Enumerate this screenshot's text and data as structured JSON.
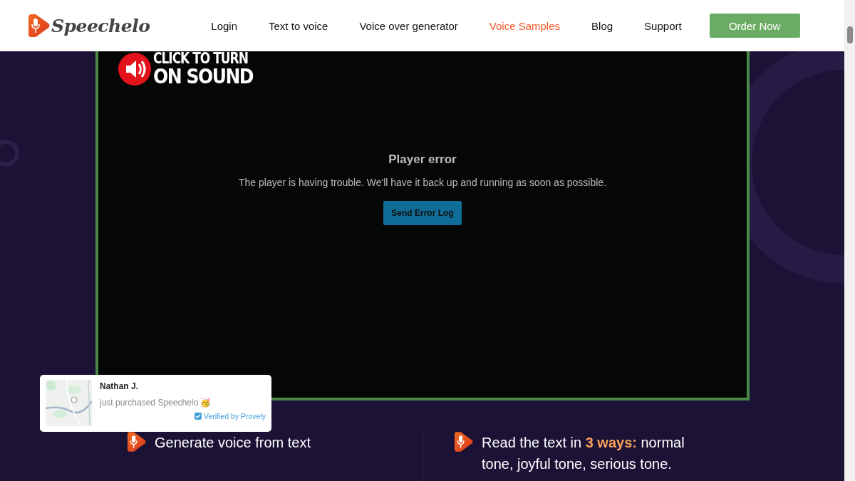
{
  "header": {
    "logo": "Speechelo",
    "nav": [
      {
        "label": "Login",
        "selected": false
      },
      {
        "label": "Text to voice",
        "selected": false
      },
      {
        "label": "Voice over generator",
        "selected": false
      },
      {
        "label": "Voice Samples",
        "selected": true
      },
      {
        "label": "Blog",
        "selected": false
      },
      {
        "label": "Support",
        "selected": false
      }
    ],
    "cta": "Order Now"
  },
  "video": {
    "sound_badge": [
      "CLICK TO TURN",
      "ON SOUND"
    ],
    "error_title": "Player error",
    "error_message": "The player is having trouble. We'll have it back up and running as soon as possible.",
    "error_button": "Send Error Log"
  },
  "notification": {
    "name": "Nathan J.",
    "message": "just purchased Speechelo",
    "emoji": "🥳",
    "verified": "Verified by Provely"
  },
  "features": [
    {
      "text": "Generate voice from text"
    },
    {
      "text": "Read the text in **3 ways:** normal tone, joyful tone, serious tone."
    }
  ]
}
